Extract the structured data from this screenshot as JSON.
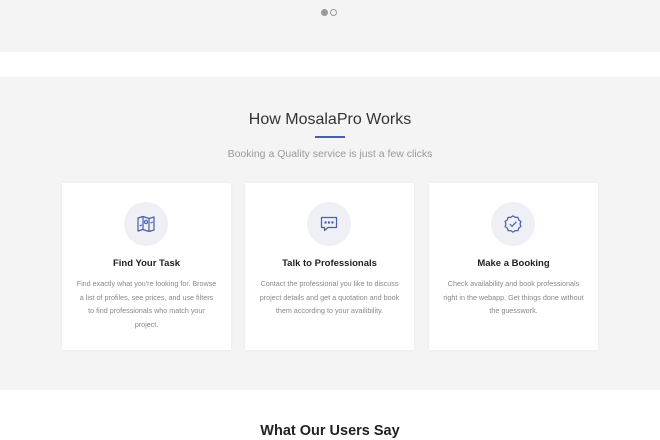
{
  "slider": {
    "dots": [
      {
        "state": "active"
      },
      {
        "state": "inactive"
      }
    ]
  },
  "how_section": {
    "title": "How MosalaPro Works",
    "subtitle": "Booking a Quality service is just a few clicks",
    "accent_color": "#4a5fa8",
    "cards": [
      {
        "icon": "map-icon",
        "title": "Find Your Task",
        "description": "Find exactly what you're looking for. Browse a list of profiles, see prices, and use filters to find professionals who match your project."
      },
      {
        "icon": "chat-bubble-icon",
        "title": "Talk to Professionals",
        "description": "Contact the professional you like to discuss project details and get a quotation and book them according to your availibility."
      },
      {
        "icon": "check-badge-icon",
        "title": "Make a Booking",
        "description": "Check availability and book professionals right in the webapp. Get things done without the guesswork."
      }
    ]
  },
  "users_section": {
    "title": "What Our Users Say"
  }
}
